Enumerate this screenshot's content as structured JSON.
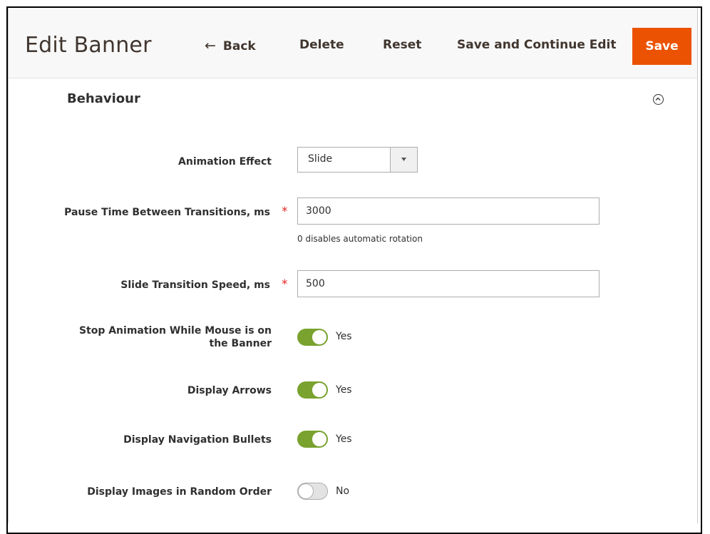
{
  "header": {
    "title": "Edit Banner",
    "back_label": "Back",
    "delete_label": "Delete",
    "reset_label": "Reset",
    "save_continue_label": "Save and Continue Edit",
    "save_label": "Save"
  },
  "section": {
    "title": "Behaviour"
  },
  "fields": {
    "animation_effect": {
      "label": "Animation Effect",
      "value": "Slide"
    },
    "pause_time": {
      "label": "Pause Time Between Transitions, ms",
      "value": "3000",
      "note": "0 disables automatic rotation",
      "required": "*"
    },
    "transition_speed": {
      "label": "Slide Transition Speed, ms",
      "value": "500",
      "required": "*"
    },
    "stop_animation": {
      "label_line1": "Stop Animation While Mouse is on",
      "label_line2": "the Banner",
      "state": "Yes",
      "on": true
    },
    "display_arrows": {
      "label": "Display Arrows",
      "state": "Yes",
      "on": true
    },
    "display_bullets": {
      "label": "Display Navigation Bullets",
      "state": "Yes",
      "on": true
    },
    "random_order": {
      "label": "Display Images in Random Order",
      "state": "No",
      "on": false
    }
  },
  "colors": {
    "accent": "#eb5202",
    "toggle_on": "#79a22e",
    "required": "#e22626"
  }
}
